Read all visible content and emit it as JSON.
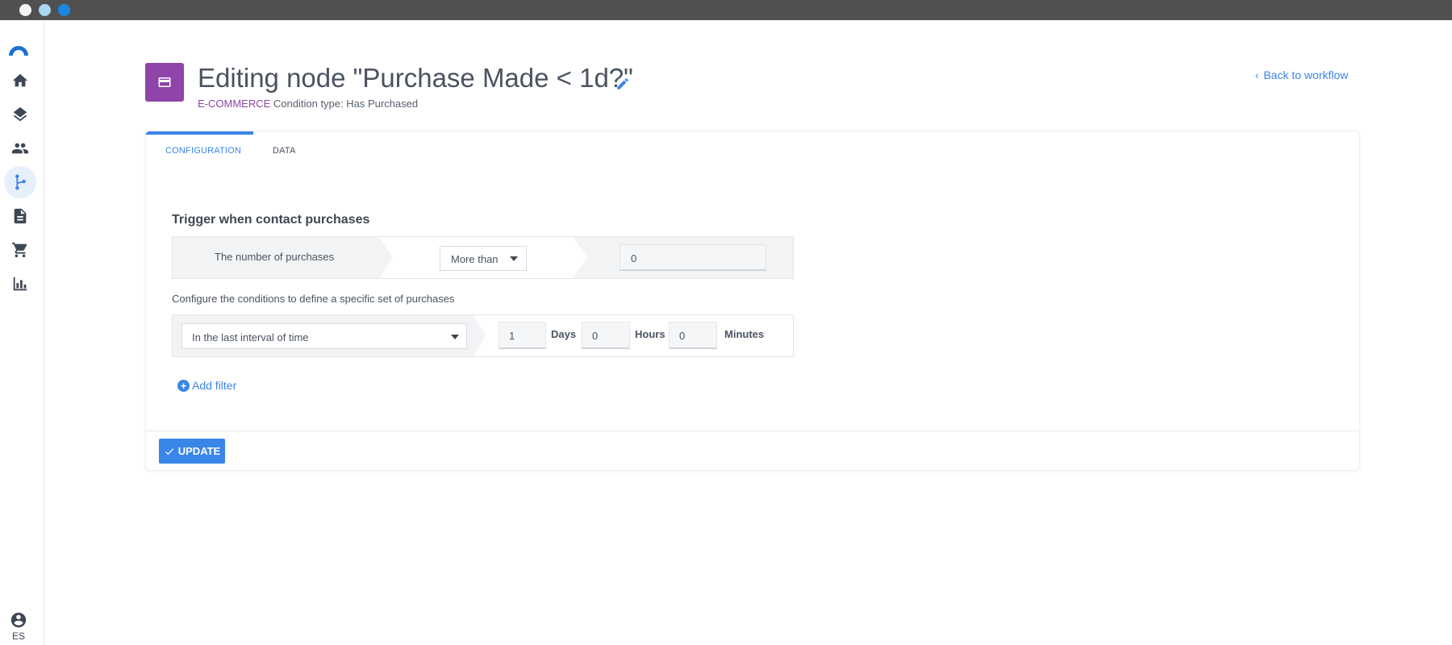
{
  "window": {
    "controls": [
      "close",
      "minimize",
      "maximize"
    ]
  },
  "sidebar": {
    "items": [
      {
        "name": "home",
        "icon": "home-icon",
        "active": false
      },
      {
        "name": "layers",
        "icon": "layers-icon",
        "active": false
      },
      {
        "name": "contacts",
        "icon": "people-icon",
        "active": false
      },
      {
        "name": "workflows",
        "icon": "workflow-branch-icon",
        "active": true
      },
      {
        "name": "documents",
        "icon": "document-icon",
        "active": false
      },
      {
        "name": "ecommerce",
        "icon": "cart-icon",
        "active": false
      },
      {
        "name": "reports",
        "icon": "bar-chart-icon",
        "active": false
      }
    ],
    "user": {
      "language": "ES"
    }
  },
  "header": {
    "title": "Editing node \"Purchase Made < 1d?\"",
    "category": "E-COMMERCE",
    "condition_type": "Condition type: Has Purchased",
    "back_link": "Back to workflow"
  },
  "tabs": [
    {
      "label": "CONFIGURATION",
      "active": true
    },
    {
      "label": "DATA",
      "active": false
    }
  ],
  "trigger": {
    "title": "Trigger when contact purchases",
    "metric_label": "The number of purchases",
    "comparator": "More than",
    "value": "0"
  },
  "conditions": {
    "helper_text": "Configure the conditions to define a specific set of purchases",
    "interval_select": "In the last interval of time",
    "days_value": "1",
    "days_label": "Days",
    "hours_value": "0",
    "hours_label": "Hours",
    "minutes_value": "0",
    "minutes_label": "Minutes"
  },
  "add_filter_label": "Add filter",
  "update_label": "UPDATE",
  "colors": {
    "accent": "#3a85e8",
    "category": "#8e44a8",
    "titlebar": "#505050"
  }
}
